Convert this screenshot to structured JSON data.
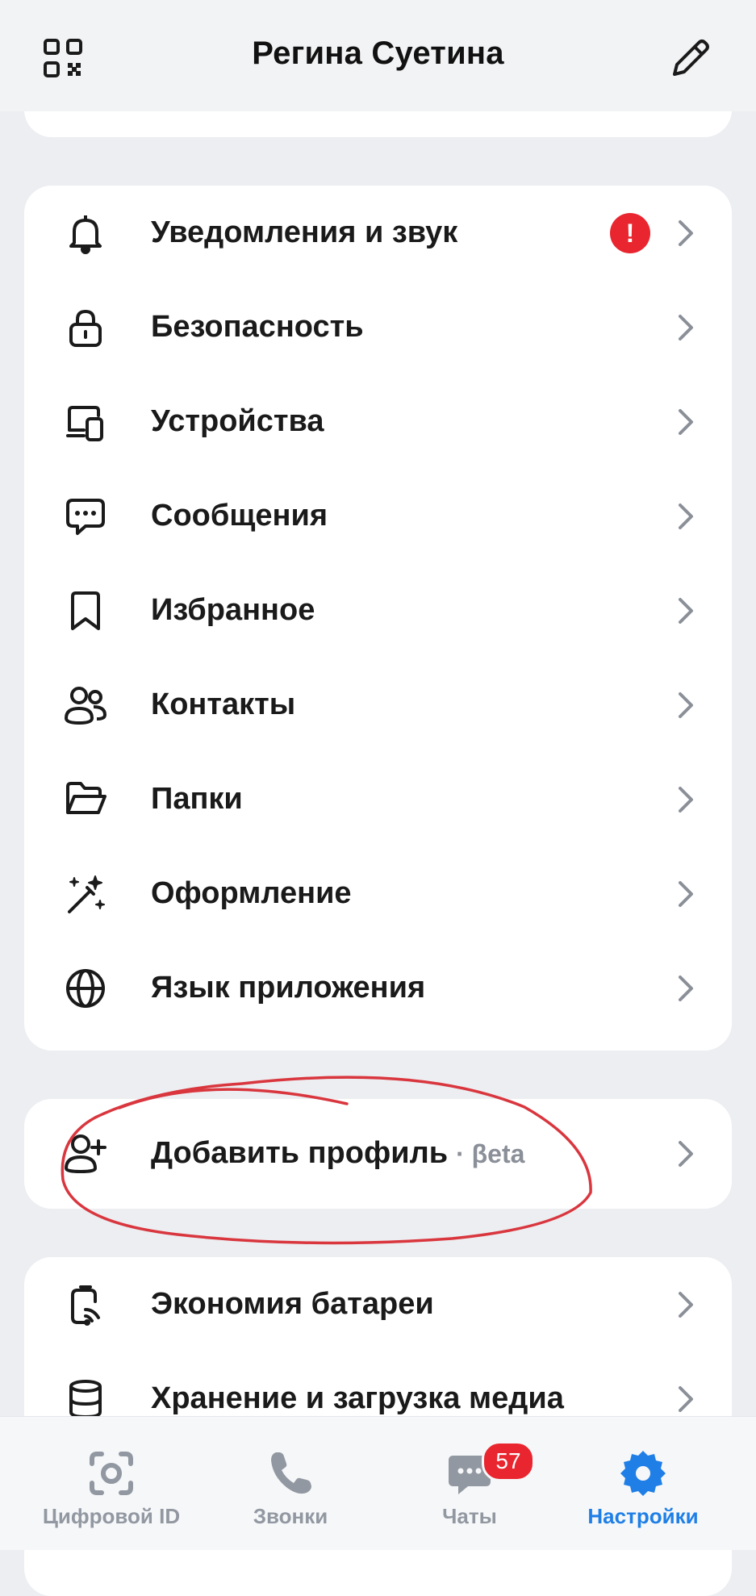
{
  "header": {
    "title": "Регина Суетина",
    "left_icon": "qr-code-icon",
    "right_icon": "pencil-edit-icon"
  },
  "settings_group_main": [
    {
      "label": "Уведомления и звук",
      "icon": "bell-icon",
      "alert_badge": "!"
    },
    {
      "label": "Безопасность",
      "icon": "lock-icon"
    },
    {
      "label": "Устройства",
      "icon": "devices-icon"
    },
    {
      "label": "Сообщения",
      "icon": "message-bubble-icon"
    },
    {
      "label": "Избранное",
      "icon": "bookmark-icon"
    },
    {
      "label": "Контакты",
      "icon": "contacts-icon"
    },
    {
      "label": "Папки",
      "icon": "folder-icon"
    },
    {
      "label": "Оформление",
      "icon": "magic-wand-icon"
    },
    {
      "label": "Язык приложения",
      "icon": "globe-icon"
    }
  ],
  "add_profile": {
    "label": "Добавить профиль",
    "tag": "· βeta",
    "icon": "person-add-icon"
  },
  "settings_group_bottom": [
    {
      "label": "Экономия батареи",
      "icon": "battery-saver-icon"
    },
    {
      "label": "Хранение и загрузка медиа",
      "icon": "storage-icon"
    }
  ],
  "tabbar": {
    "tabs": [
      {
        "label": "Цифровой ID",
        "icon": "face-scan-icon",
        "active": false
      },
      {
        "label": "Звонки",
        "icon": "phone-icon",
        "active": false
      },
      {
        "label": "Чаты",
        "icon": "chat-icon",
        "active": false,
        "badge": "57"
      },
      {
        "label": "Настройки",
        "icon": "gear-icon",
        "active": true
      }
    ]
  },
  "colors": {
    "accent": "#1f7fe6",
    "alert": "#e9262f",
    "annotation": "#d9363e",
    "background": "#eceef1"
  }
}
